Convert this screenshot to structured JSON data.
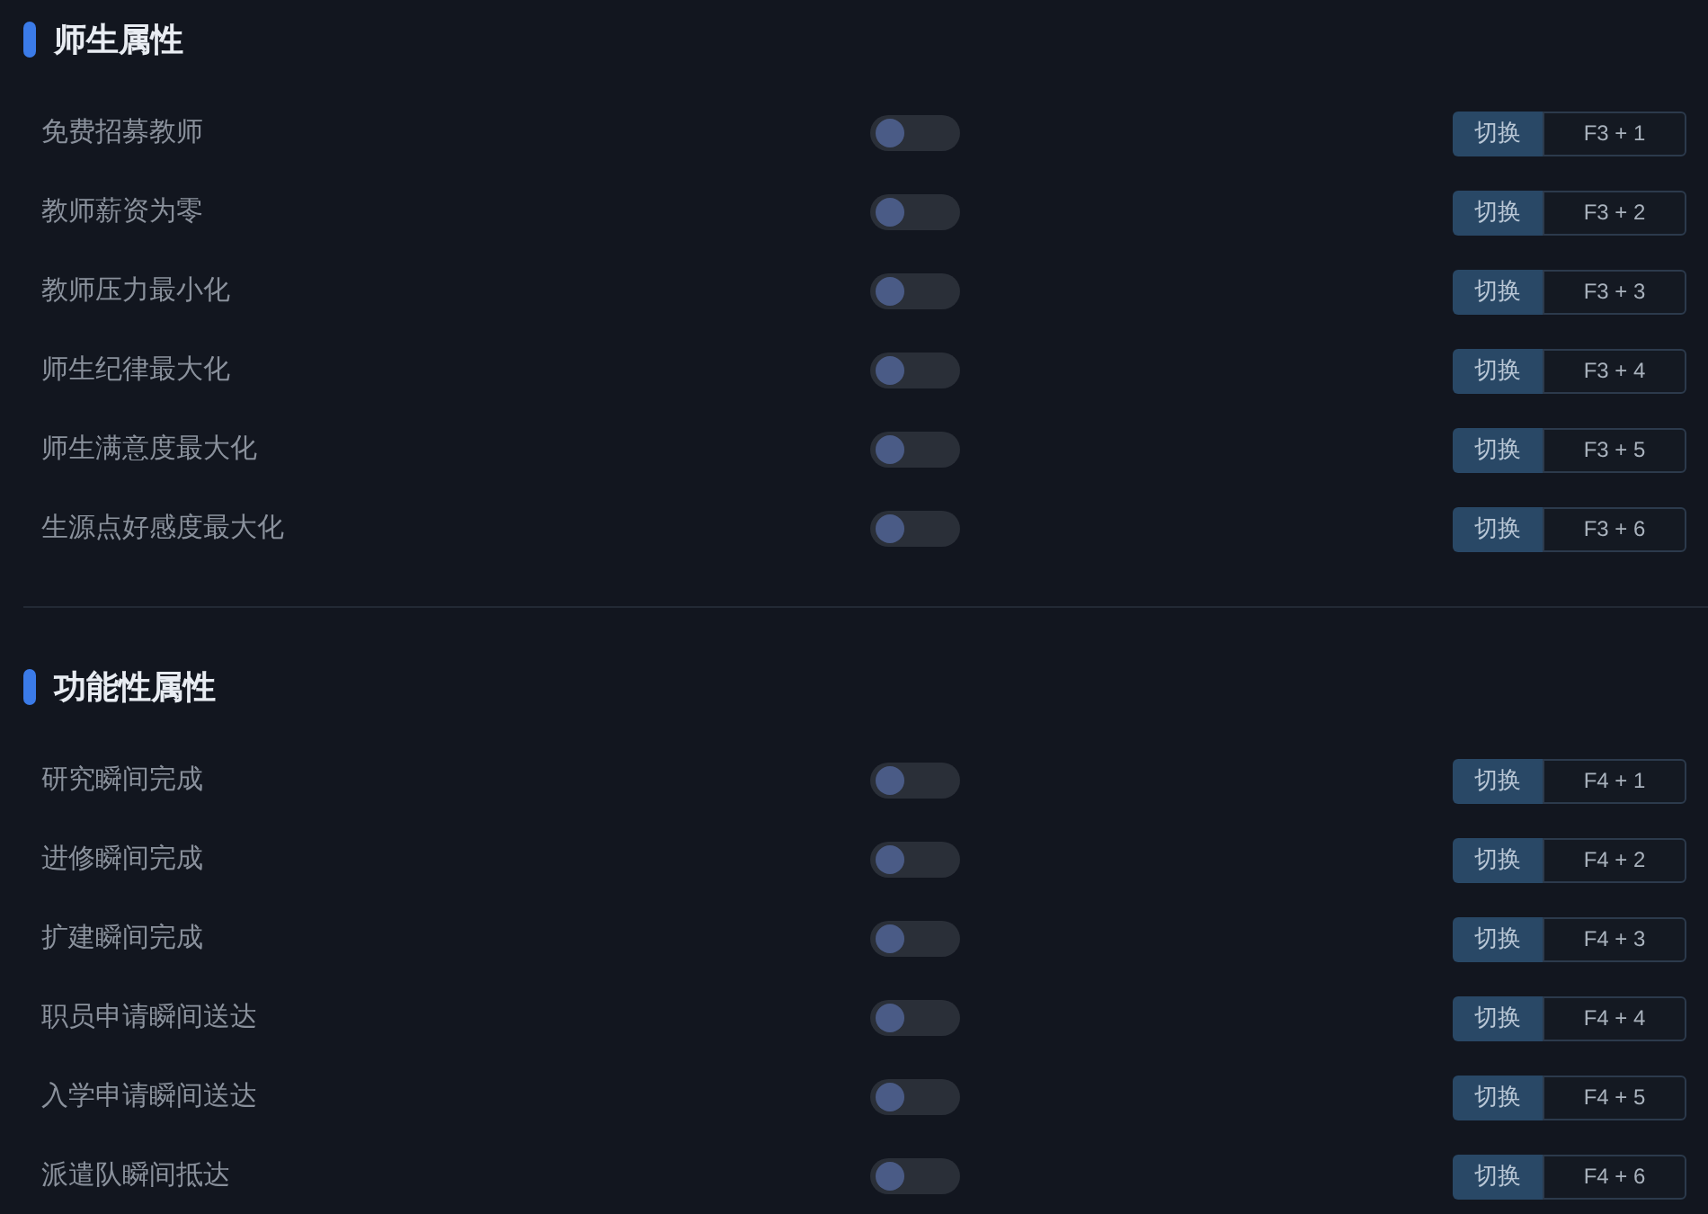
{
  "sections": [
    {
      "title": "师生属性",
      "options": [
        {
          "label": "免费招募教师",
          "on": false,
          "action": "切换",
          "hotkey": "F3 + 1"
        },
        {
          "label": "教师薪资为零",
          "on": false,
          "action": "切换",
          "hotkey": "F3 + 2"
        },
        {
          "label": "教师压力最小化",
          "on": false,
          "action": "切换",
          "hotkey": "F3 + 3"
        },
        {
          "label": "师生纪律最大化",
          "on": false,
          "action": "切换",
          "hotkey": "F3 + 4"
        },
        {
          "label": "师生满意度最大化",
          "on": false,
          "action": "切换",
          "hotkey": "F3 + 5"
        },
        {
          "label": "生源点好感度最大化",
          "on": false,
          "action": "切换",
          "hotkey": "F3 + 6"
        }
      ]
    },
    {
      "title": "功能性属性",
      "options": [
        {
          "label": "研究瞬间完成",
          "on": false,
          "action": "切换",
          "hotkey": "F4 + 1"
        },
        {
          "label": "进修瞬间完成",
          "on": false,
          "action": "切换",
          "hotkey": "F4 + 2"
        },
        {
          "label": "扩建瞬间完成",
          "on": false,
          "action": "切换",
          "hotkey": "F4 + 3"
        },
        {
          "label": "职员申请瞬间送达",
          "on": false,
          "action": "切换",
          "hotkey": "F4 + 4"
        },
        {
          "label": "入学申请瞬间送达",
          "on": false,
          "action": "切换",
          "hotkey": "F4 + 5"
        },
        {
          "label": "派遣队瞬间抵达",
          "on": false,
          "action": "切换",
          "hotkey": "F4 + 6"
        }
      ]
    }
  ]
}
